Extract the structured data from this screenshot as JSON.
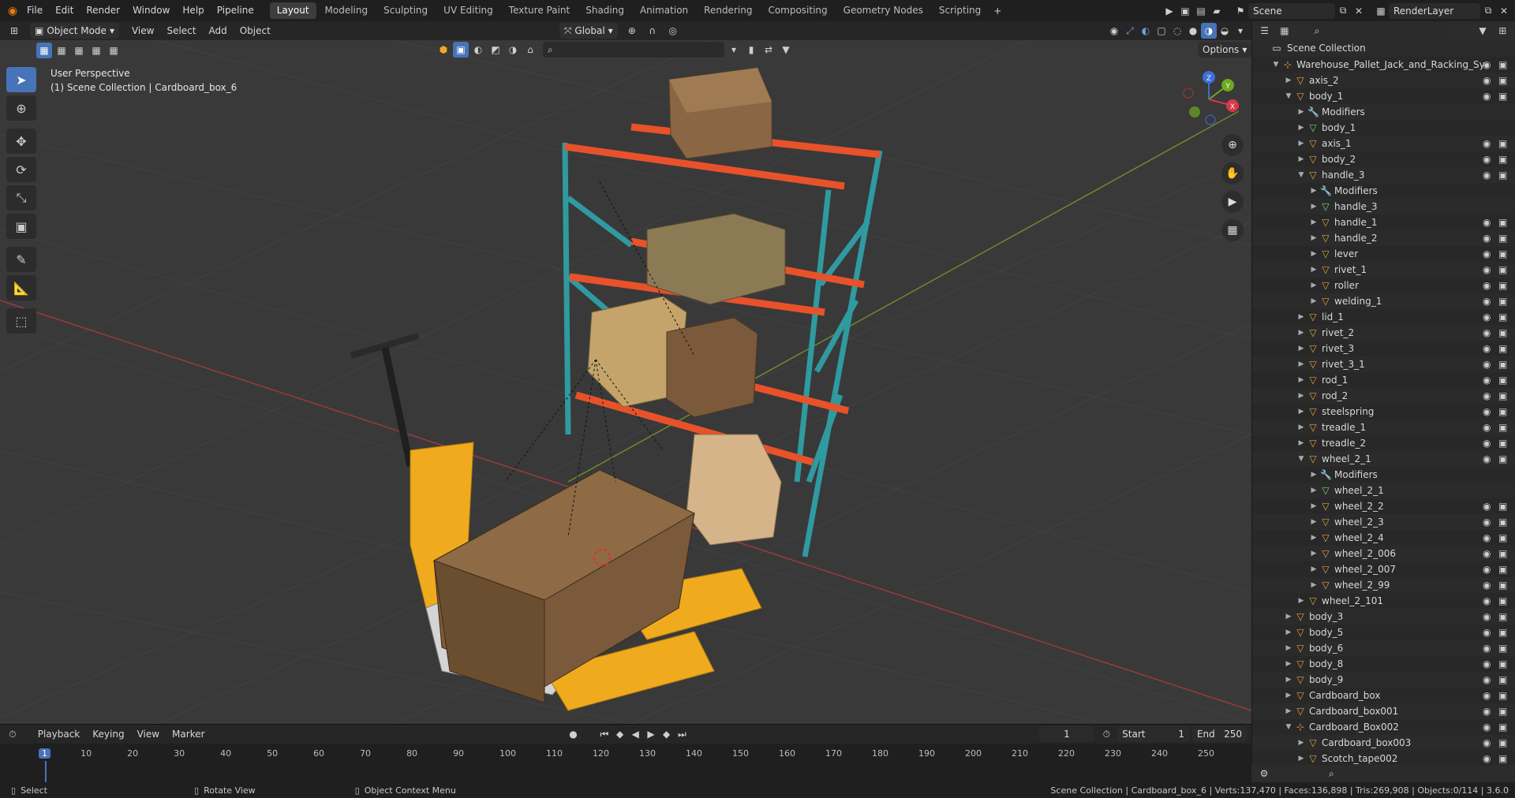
{
  "top_menu": [
    "File",
    "Edit",
    "Render",
    "Window",
    "Help",
    "Pipeline"
  ],
  "workspaces": [
    "Layout",
    "Modeling",
    "Sculpting",
    "UV Editing",
    "Texture Paint",
    "Shading",
    "Animation",
    "Rendering",
    "Compositing",
    "Geometry Nodes",
    "Scripting"
  ],
  "active_workspace": "Layout",
  "scene_name": "Scene",
  "render_layer": "RenderLayer",
  "viewport_header": {
    "mode": "Object Mode",
    "menus": [
      "View",
      "Select",
      "Add",
      "Object"
    ],
    "transform_orientation": "Global",
    "options_label": "Options"
  },
  "viewport_info": {
    "perspective": "User Perspective",
    "context": "(1) Scene Collection | Cardboard_box_6"
  },
  "gizmo_axes": [
    "X",
    "Y",
    "Z"
  ],
  "outliner": {
    "root": "Scene Collection",
    "rows": [
      {
        "label": "Warehouse_Pallet_Jack_and_Racking_Sy",
        "depth": 1,
        "expanded": true,
        "icon": "empty"
      },
      {
        "label": "axis_2",
        "depth": 2,
        "expanded": false,
        "icon": "mesh"
      },
      {
        "label": "body_1",
        "depth": 2,
        "expanded": true,
        "icon": "mesh"
      },
      {
        "label": "Modifiers",
        "depth": 3,
        "expanded": false,
        "icon": "wrench"
      },
      {
        "label": "body_1",
        "depth": 3,
        "expanded": false,
        "icon": "data"
      },
      {
        "label": "axis_1",
        "depth": 3,
        "expanded": false,
        "icon": "mesh"
      },
      {
        "label": "body_2",
        "depth": 3,
        "expanded": false,
        "icon": "mesh"
      },
      {
        "label": "handle_3",
        "depth": 3,
        "expanded": true,
        "icon": "mesh"
      },
      {
        "label": "Modifiers",
        "depth": 4,
        "expanded": false,
        "icon": "wrench"
      },
      {
        "label": "handle_3",
        "depth": 4,
        "expanded": false,
        "icon": "data"
      },
      {
        "label": "handle_1",
        "depth": 4,
        "expanded": false,
        "icon": "mesh"
      },
      {
        "label": "handle_2",
        "depth": 4,
        "expanded": false,
        "icon": "mesh"
      },
      {
        "label": "lever",
        "depth": 4,
        "expanded": false,
        "icon": "mesh"
      },
      {
        "label": "rivet_1",
        "depth": 4,
        "expanded": false,
        "icon": "mesh"
      },
      {
        "label": "roller",
        "depth": 4,
        "expanded": false,
        "icon": "mesh"
      },
      {
        "label": "welding_1",
        "depth": 4,
        "expanded": false,
        "icon": "mesh"
      },
      {
        "label": "lid_1",
        "depth": 3,
        "expanded": false,
        "icon": "mesh"
      },
      {
        "label": "rivet_2",
        "depth": 3,
        "expanded": false,
        "icon": "mesh"
      },
      {
        "label": "rivet_3",
        "depth": 3,
        "expanded": false,
        "icon": "mesh"
      },
      {
        "label": "rivet_3_1",
        "depth": 3,
        "expanded": false,
        "icon": "mesh"
      },
      {
        "label": "rod_1",
        "depth": 3,
        "expanded": false,
        "icon": "mesh"
      },
      {
        "label": "rod_2",
        "depth": 3,
        "expanded": false,
        "icon": "mesh"
      },
      {
        "label": "steelspring",
        "depth": 3,
        "expanded": false,
        "icon": "mesh"
      },
      {
        "label": "treadle_1",
        "depth": 3,
        "expanded": false,
        "icon": "mesh"
      },
      {
        "label": "treadle_2",
        "depth": 3,
        "expanded": false,
        "icon": "mesh"
      },
      {
        "label": "wheel_2_1",
        "depth": 3,
        "expanded": true,
        "icon": "mesh"
      },
      {
        "label": "Modifiers",
        "depth": 4,
        "expanded": false,
        "icon": "wrench"
      },
      {
        "label": "wheel_2_1",
        "depth": 4,
        "expanded": false,
        "icon": "data"
      },
      {
        "label": "wheel_2_2",
        "depth": 4,
        "expanded": false,
        "icon": "mesh"
      },
      {
        "label": "wheel_2_3",
        "depth": 4,
        "expanded": false,
        "icon": "mesh"
      },
      {
        "label": "wheel_2_4",
        "depth": 4,
        "expanded": false,
        "icon": "mesh"
      },
      {
        "label": "wheel_2_006",
        "depth": 4,
        "expanded": false,
        "icon": "mesh"
      },
      {
        "label": "wheel_2_007",
        "depth": 4,
        "expanded": false,
        "icon": "mesh"
      },
      {
        "label": "wheel_2_99",
        "depth": 4,
        "expanded": false,
        "icon": "mesh"
      },
      {
        "label": "wheel_2_101",
        "depth": 3,
        "expanded": false,
        "icon": "mesh"
      },
      {
        "label": "body_3",
        "depth": 2,
        "expanded": false,
        "icon": "mesh"
      },
      {
        "label": "body_5",
        "depth": 2,
        "expanded": false,
        "icon": "mesh"
      },
      {
        "label": "body_6",
        "depth": 2,
        "expanded": false,
        "icon": "mesh"
      },
      {
        "label": "body_8",
        "depth": 2,
        "expanded": false,
        "icon": "mesh"
      },
      {
        "label": "body_9",
        "depth": 2,
        "expanded": false,
        "icon": "mesh"
      },
      {
        "label": "Cardboard_box",
        "depth": 2,
        "expanded": false,
        "icon": "mesh"
      },
      {
        "label": "Cardboard_box001",
        "depth": 2,
        "expanded": false,
        "icon": "mesh"
      },
      {
        "label": "Cardboard_Box002",
        "depth": 2,
        "expanded": true,
        "icon": "empty"
      },
      {
        "label": "Cardboard_box003",
        "depth": 3,
        "expanded": false,
        "icon": "mesh"
      },
      {
        "label": "Scotch_tape002",
        "depth": 3,
        "expanded": false,
        "icon": "mesh"
      }
    ]
  },
  "timeline": {
    "menus": [
      "Playback",
      "Keying",
      "View",
      "Marker"
    ],
    "current_frame": "1",
    "start_label": "Start",
    "start": "1",
    "end_label": "End",
    "end": "250",
    "ticks": [
      "1",
      "10",
      "20",
      "30",
      "40",
      "50",
      "60",
      "70",
      "80",
      "90",
      "100",
      "110",
      "120",
      "130",
      "140",
      "150",
      "160",
      "170",
      "180",
      "190",
      "200",
      "210",
      "220",
      "230",
      "240",
      "250"
    ]
  },
  "statusbar": {
    "left": "Select",
    "middle": "Rotate View",
    "right": "Object Context Menu",
    "stats": "Scene Collection | Cardboard_box_6 | Verts:137,470 | Faces:136,898 | Tris:269,908 | Objects:0/114 | 3.6.0"
  },
  "colors": {
    "accent": "#4773b8",
    "rack_orange": "#e8522a",
    "rack_teal": "#2f9aa0",
    "jack_yellow": "#f0aa1e",
    "box_brown": "#7a5a3a"
  }
}
